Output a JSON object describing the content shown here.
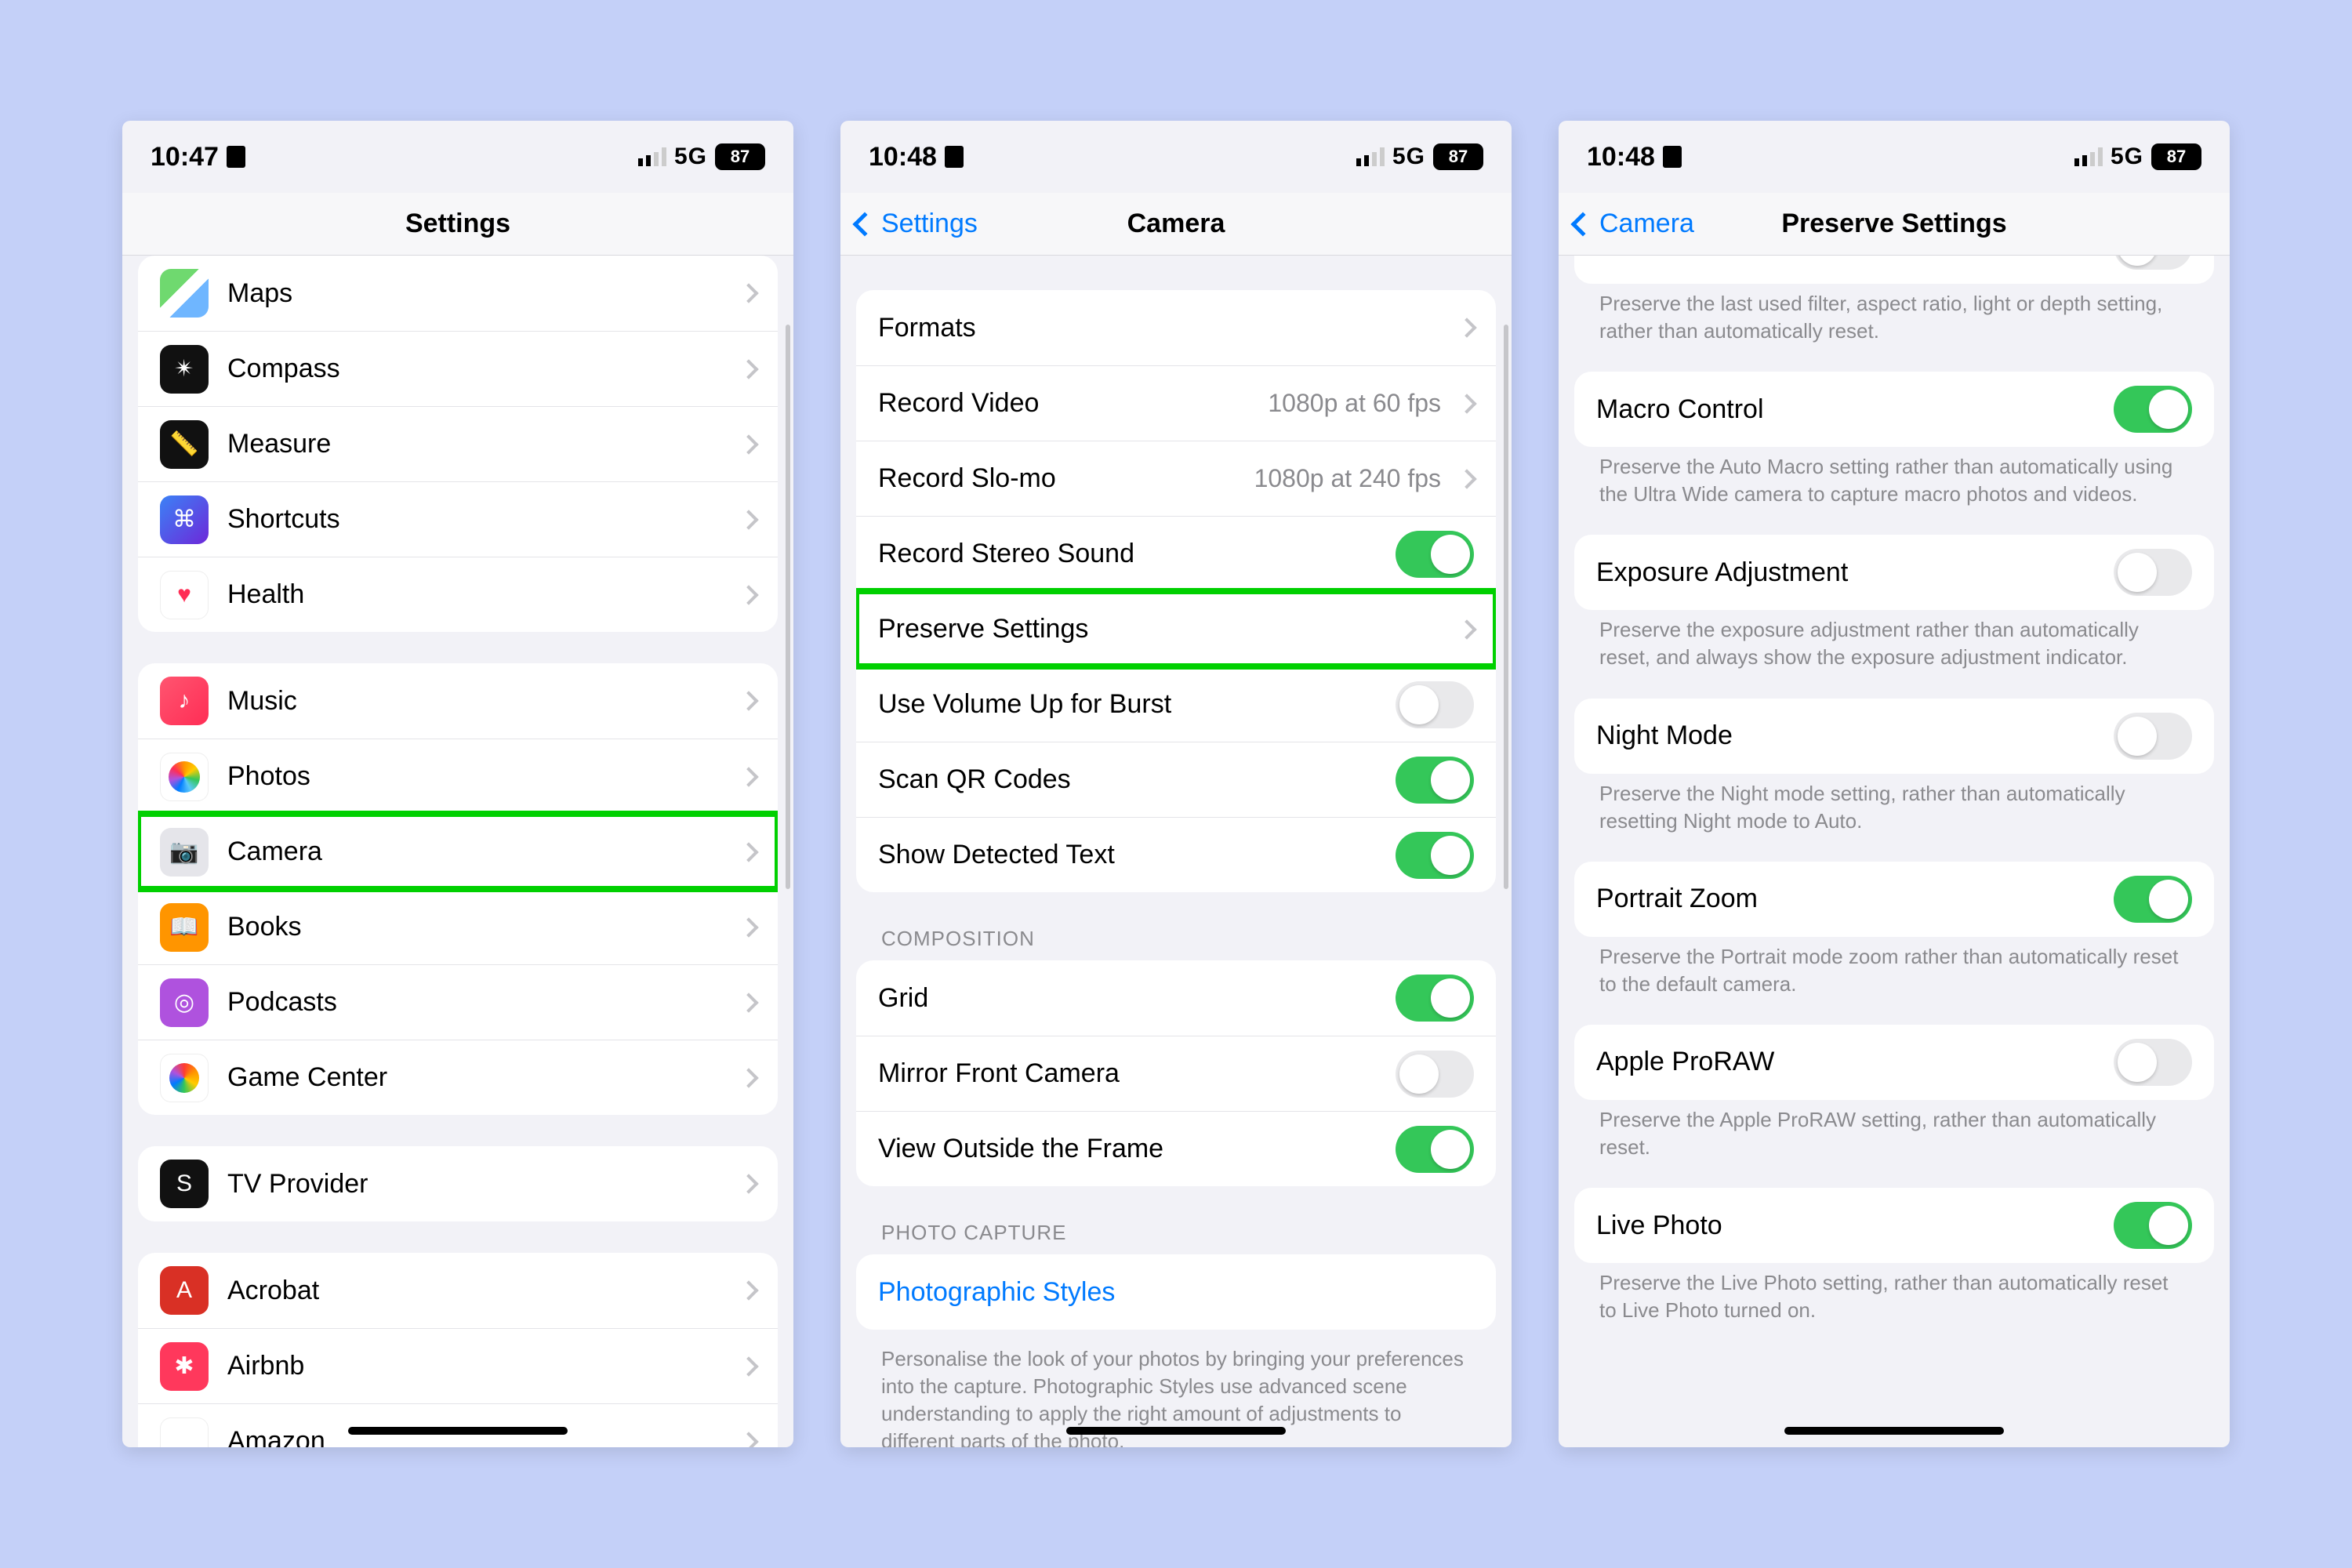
{
  "status": {
    "battery": "87",
    "net": "5G"
  },
  "screen1": {
    "time": "10:47",
    "title": "Settings",
    "groupA": [
      {
        "name": "maps",
        "label": "Maps",
        "iconClass": "ic-maps",
        "glyph": ""
      },
      {
        "name": "compass",
        "label": "Compass",
        "iconClass": "ic-compass",
        "glyph": "✴︎"
      },
      {
        "name": "measure",
        "label": "Measure",
        "iconClass": "ic-measure",
        "glyph": "📏"
      },
      {
        "name": "shortcuts",
        "label": "Shortcuts",
        "iconClass": "ic-shortcuts",
        "glyph": "⌘"
      },
      {
        "name": "health",
        "label": "Health",
        "iconClass": "ic-health",
        "glyph": "♥"
      }
    ],
    "groupB": [
      {
        "name": "music",
        "label": "Music",
        "iconClass": "ic-music",
        "glyph": "♪"
      },
      {
        "name": "photos",
        "label": "Photos",
        "iconClass": "ic-photos",
        "glyph": "photos"
      },
      {
        "name": "camera",
        "label": "Camera",
        "iconClass": "ic-camera",
        "glyph": "📷",
        "highlight": true
      },
      {
        "name": "books",
        "label": "Books",
        "iconClass": "ic-books",
        "glyph": "📖"
      },
      {
        "name": "podcasts",
        "label": "Podcasts",
        "iconClass": "ic-podcasts",
        "glyph": "◎"
      },
      {
        "name": "gamecenter",
        "label": "Game Center",
        "iconClass": "ic-gamecenter",
        "glyph": "gc"
      }
    ],
    "groupC": [
      {
        "name": "tvprovider",
        "label": "TV Provider",
        "iconClass": "ic-tv",
        "glyph": "S"
      }
    ],
    "groupD": [
      {
        "name": "acrobat",
        "label": "Acrobat",
        "iconClass": "ic-acrobat",
        "glyph": "A"
      },
      {
        "name": "airbnb",
        "label": "Airbnb",
        "iconClass": "ic-airbnb",
        "glyph": "✱"
      },
      {
        "name": "amazon",
        "label": "Amazon",
        "iconClass": "ic-amazon",
        "glyph": "⌣"
      }
    ]
  },
  "screen2": {
    "time": "10:48",
    "back": "Settings",
    "title": "Camera",
    "rows": [
      {
        "name": "formats",
        "label": "Formats",
        "type": "disclosure"
      },
      {
        "name": "record-video",
        "label": "Record Video",
        "type": "disclosure",
        "detail": "1080p at 60 fps"
      },
      {
        "name": "record-slomo",
        "label": "Record Slo-mo",
        "type": "disclosure",
        "detail": "1080p at 240 fps"
      },
      {
        "name": "record-stereo",
        "label": "Record Stereo Sound",
        "type": "toggle",
        "on": true
      },
      {
        "name": "preserve-settings",
        "label": "Preserve Settings",
        "type": "disclosure",
        "highlight": true
      },
      {
        "name": "volume-up-burst",
        "label": "Use Volume Up for Burst",
        "type": "toggle",
        "on": false
      },
      {
        "name": "scan-qr",
        "label": "Scan QR Codes",
        "type": "toggle",
        "on": true
      },
      {
        "name": "detected-text",
        "label": "Show Detected Text",
        "type": "toggle",
        "on": true
      }
    ],
    "composition_header": "COMPOSITION",
    "composition": [
      {
        "name": "grid",
        "label": "Grid",
        "type": "toggle",
        "on": true
      },
      {
        "name": "mirror-front",
        "label": "Mirror Front Camera",
        "type": "toggle",
        "on": false
      },
      {
        "name": "view-outside-frame",
        "label": "View Outside the Frame",
        "type": "toggle",
        "on": true
      }
    ],
    "photo_capture_header": "PHOTO CAPTURE",
    "photographic_styles": "Photographic Styles",
    "photo_capture_footer": "Personalise the look of your photos by bringing your preferences into the capture. Photographic Styles use advanced scene understanding to apply the right amount of adjustments to different parts of the photo."
  },
  "screen3": {
    "time": "10:48",
    "back": "Camera",
    "title": "Preserve Settings",
    "top_footer": "Preserve the last used filter, aspect ratio, light or depth setting, rather than automatically reset.",
    "items": [
      {
        "name": "macro-control",
        "label": "Macro Control",
        "on": true,
        "footer": "Preserve the Auto Macro setting rather than automatically using the Ultra Wide camera to capture macro photos and videos."
      },
      {
        "name": "exposure-adjustment",
        "label": "Exposure Adjustment",
        "on": false,
        "footer": "Preserve the exposure adjustment rather than automatically reset, and always show the exposure adjustment indicator."
      },
      {
        "name": "night-mode",
        "label": "Night Mode",
        "on": false,
        "footer": "Preserve the Night mode setting, rather than automatically resetting Night mode to Auto."
      },
      {
        "name": "portrait-zoom",
        "label": "Portrait Zoom",
        "on": true,
        "footer": "Preserve the Portrait mode zoom rather than automatically reset to the default camera."
      },
      {
        "name": "apple-proraw",
        "label": "Apple ProRAW",
        "on": false,
        "footer": "Preserve the Apple ProRAW setting, rather than automatically reset."
      },
      {
        "name": "live-photo",
        "label": "Live Photo",
        "on": true,
        "footer": "Preserve the Live Photo setting, rather than automatically reset to Live Photo turned on."
      }
    ]
  }
}
